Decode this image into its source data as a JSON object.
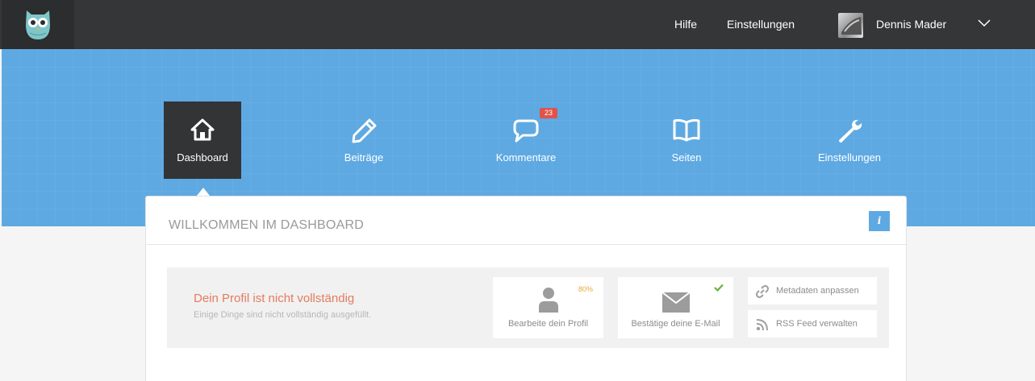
{
  "topbar": {
    "links": [
      "Hilfe",
      "Einstellungen"
    ],
    "user_name": "Dennis Mader"
  },
  "nav": {
    "items": [
      {
        "label": "Dashboard",
        "icon": "home-icon",
        "active": true
      },
      {
        "label": "Beiträge",
        "icon": "pencil-icon"
      },
      {
        "label": "Kommentare",
        "icon": "speech-bubble-icon",
        "badge": "23"
      },
      {
        "label": "Seiten",
        "icon": "book-icon"
      },
      {
        "label": "Einstellungen",
        "icon": "wrench-icon"
      }
    ]
  },
  "card": {
    "title": "WILLKOMMEN IM DASHBOARD",
    "info_label": "i",
    "profile": {
      "title": "Dein Profil ist nicht vollständig",
      "subtitle": "Einige Dinge sind nicht vollständig ausgefüllt.",
      "tiles": [
        {
          "label": "Bearbeite dein Profil",
          "icon": "user-icon",
          "progress": "80%"
        },
        {
          "label": "Bestätige deine E-Mail",
          "icon": "envelope-icon",
          "status": "check-icon"
        }
      ],
      "actions": [
        {
          "label": "Metadaten anpassen",
          "icon": "link-icon"
        },
        {
          "label": "RSS Feed verwalten",
          "icon": "rss-icon"
        }
      ]
    }
  },
  "colors": {
    "topbar": "#343638",
    "hero": "#5ea9e2",
    "active_nav": "#323436",
    "badge": "#e0534a",
    "profile_warning": "#e57b5e",
    "progress": "#e8a93a",
    "check": "#6cb33f"
  }
}
